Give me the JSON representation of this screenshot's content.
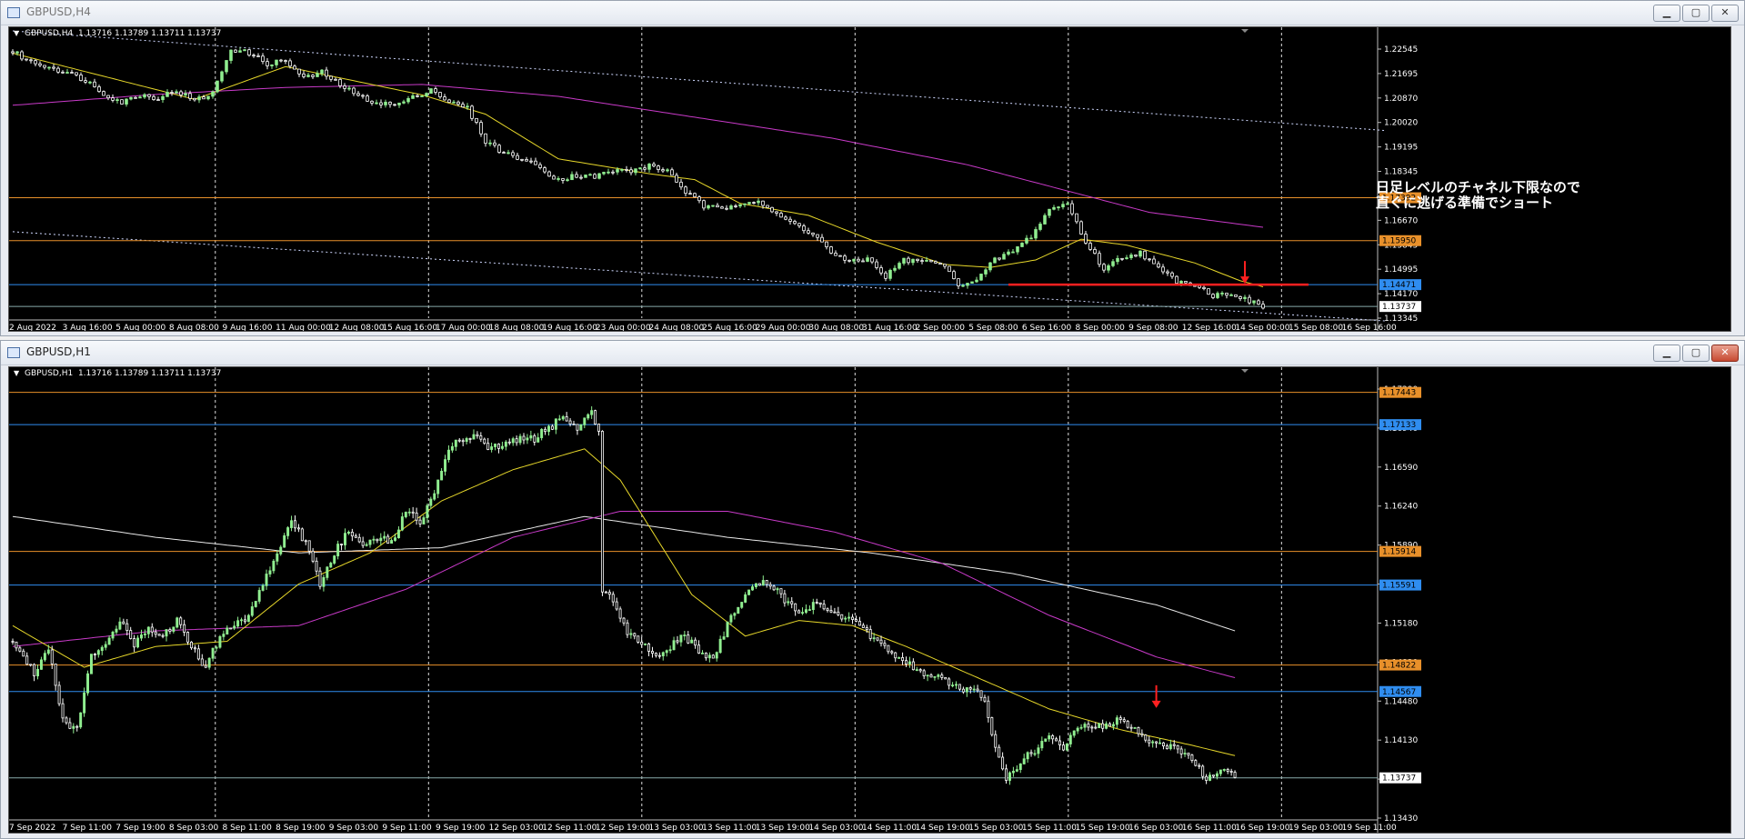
{
  "windows": [
    {
      "title": "GBPUSD,H4",
      "symbol_label": "GBPUSD,H4",
      "ohlc": "1.13716 1.13789 1.13711 1.13737",
      "annotation_line1": "日足レベルのチャネル下限なので",
      "annotation_line2": "直ぐに逃げる準備でショート"
    },
    {
      "title": "GBPUSD,H1",
      "symbol_label": "GBPUSD,H1",
      "ohlc": "1.13716 1.13789 1.13711 1.13737"
    }
  ],
  "chart_data": [
    {
      "type": "candlestick",
      "symbol": "GBPUSD",
      "timeframe": "H4",
      "ylim": [
        1.13345,
        1.23
      ],
      "y_ticks": [
        "1.22545",
        "1.21695",
        "1.20870",
        "1.20020",
        "1.19195",
        "1.18345",
        "1.17520",
        "1.16670",
        "1.15845",
        "1.14995",
        "1.14170",
        "1.13345"
      ],
      "x_ticks": [
        "2 Aug 2022",
        "3 Aug 16:00",
        "5 Aug 00:00",
        "8 Aug 08:00",
        "9 Aug 16:00",
        "11 Aug 00:00",
        "12 Aug 08:00",
        "15 Aug 16:00",
        "17 Aug 00:00",
        "18 Aug 08:00",
        "19 Aug 16:00",
        "23 Aug 00:00",
        "24 Aug 08:00",
        "25 Aug 16:00",
        "29 Aug 00:00",
        "30 Aug 08:00",
        "31 Aug 16:00",
        "2 Sep 00:00",
        "5 Sep 08:00",
        "6 Sep 16:00",
        "8 Sep 00:00",
        "9 Sep 08:00",
        "12 Sep 16:00",
        "14 Sep 00:00",
        "15 Sep 08:00",
        "16 Sep 16:00"
      ],
      "close_path": [
        [
          0,
          1.223
        ],
        [
          4,
          1.2195
        ],
        [
          8,
          1.218
        ],
        [
          12,
          1.216
        ],
        [
          16,
          1.2135
        ],
        [
          20,
          1.209
        ],
        [
          24,
          1.206
        ],
        [
          28,
          1.2085
        ],
        [
          32,
          1.2075
        ],
        [
          36,
          1.21
        ],
        [
          40,
          1.2065
        ],
        [
          44,
          1.209
        ],
        [
          48,
          1.224
        ],
        [
          52,
          1.2225
        ],
        [
          56,
          1.219
        ],
        [
          60,
          1.22
        ],
        [
          64,
          1.214
        ],
        [
          68,
          1.216
        ],
        [
          72,
          1.212
        ],
        [
          76,
          1.208
        ],
        [
          80,
          1.206
        ],
        [
          84,
          1.205
        ],
        [
          88,
          1.2075
        ],
        [
          92,
          1.2105
        ],
        [
          96,
          1.206
        ],
        [
          100,
          1.204
        ],
        [
          104,
          1.193
        ],
        [
          108,
          1.189
        ],
        [
          112,
          1.187
        ],
        [
          116,
          1.184
        ],
        [
          120,
          1.18
        ],
        [
          124,
          1.1815
        ],
        [
          128,
          1.181
        ],
        [
          132,
          1.183
        ],
        [
          136,
          1.183
        ],
        [
          140,
          1.1845
        ],
        [
          144,
          1.183
        ],
        [
          148,
          1.176
        ],
        [
          152,
          1.171
        ],
        [
          156,
          1.17
        ],
        [
          160,
          1.1725
        ],
        [
          164,
          1.173
        ],
        [
          168,
          1.168
        ],
        [
          172,
          1.165
        ],
        [
          176,
          1.162
        ],
        [
          180,
          1.1555
        ],
        [
          184,
          1.152
        ],
        [
          188,
          1.1535
        ],
        [
          192,
          1.1475
        ],
        [
          196,
          1.153
        ],
        [
          200,
          1.1525
        ],
        [
          204,
          1.152
        ],
        [
          208,
          1.145
        ],
        [
          212,
          1.146
        ],
        [
          216,
          1.153
        ],
        [
          220,
          1.156
        ],
        [
          224,
          1.161
        ],
        [
          228,
          1.17
        ],
        [
          232,
          1.172
        ],
        [
          236,
          1.159
        ],
        [
          240,
          1.15
        ],
        [
          244,
          1.154
        ],
        [
          248,
          1.1555
        ],
        [
          252,
          1.15
        ],
        [
          256,
          1.146
        ],
        [
          260,
          1.145
        ],
        [
          264,
          1.141
        ],
        [
          268,
          1.142
        ],
        [
          272,
          1.139
        ],
        [
          275,
          1.13737
        ]
      ],
      "sma_fast": [
        [
          0,
          1.2225
        ],
        [
          40,
          1.207
        ],
        [
          60,
          1.218
        ],
        [
          90,
          1.2085
        ],
        [
          104,
          1.202
        ],
        [
          120,
          1.187
        ],
        [
          140,
          1.182
        ],
        [
          150,
          1.18
        ],
        [
          160,
          1.172
        ],
        [
          175,
          1.168
        ],
        [
          190,
          1.159
        ],
        [
          205,
          1.1515
        ],
        [
          215,
          1.1505
        ],
        [
          225,
          1.153
        ],
        [
          235,
          1.16
        ],
        [
          245,
          1.158
        ],
        [
          260,
          1.152
        ],
        [
          270,
          1.146
        ],
        [
          275,
          1.144
        ]
      ],
      "sma_slow": [
        [
          0,
          1.205
        ],
        [
          30,
          1.2085
        ],
        [
          60,
          1.211
        ],
        [
          90,
          1.212
        ],
        [
          120,
          1.208
        ],
        [
          150,
          1.201
        ],
        [
          180,
          1.194
        ],
        [
          210,
          1.185
        ],
        [
          230,
          1.177
        ],
        [
          250,
          1.169
        ],
        [
          275,
          1.164
        ]
      ],
      "channel_upper": [
        [
          0,
          1.23
        ],
        [
          302,
          1.1965
        ]
      ],
      "channel_lower": [
        [
          0,
          1.1625
        ],
        [
          302,
          1.1325
        ]
      ],
      "horizontal_levels": [
        {
          "price": 1.17392,
          "label": "1.17392",
          "color": "#e8902a",
          "style": "orange"
        },
        {
          "price": 1.1595,
          "label": "1.15950",
          "color": "#e8902a",
          "style": "orange"
        },
        {
          "price": 1.14471,
          "label": "1.14471",
          "color": "#2f8df0",
          "style": "blue"
        },
        {
          "price": 1.13737,
          "label": "1.13737",
          "color": "#ffffff",
          "style": "current"
        }
      ],
      "entry_line": {
        "from": 219,
        "to": 285,
        "price": 1.1447,
        "color": "#ff2020"
      },
      "arrow": {
        "x": 271,
        "price": 1.1447,
        "color": "#ff2020"
      },
      "colors": {
        "bull": "#90ee90",
        "bear": "#ffffff",
        "sma_fast": "#e6d72a",
        "sma_slow": "#c83ac8"
      }
    },
    {
      "type": "candlestick",
      "symbol": "GBPUSD",
      "timeframe": "H1",
      "ylim": [
        1.1335,
        1.1765
      ],
      "y_ticks": [
        "1.17290",
        "1.16940",
        "1.16590",
        "1.16240",
        "1.15890",
        "1.15540",
        "1.15180",
        "1.14830",
        "1.14480",
        "1.14130",
        "1.13780",
        "1.13430"
      ],
      "x_ticks": [
        "7 Sep 2022",
        "7 Sep 11:00",
        "7 Sep 19:00",
        "8 Sep 03:00",
        "8 Sep 11:00",
        "8 Sep 19:00",
        "9 Sep 03:00",
        "9 Sep 11:00",
        "9 Sep 19:00",
        "12 Sep 03:00",
        "12 Sep 11:00",
        "12 Sep 19:00",
        "13 Sep 03:00",
        "13 Sep 11:00",
        "13 Sep 19:00",
        "14 Sep 03:00",
        "14 Sep 11:00",
        "14 Sep 19:00",
        "15 Sep 03:00",
        "15 Sep 11:00",
        "15 Sep 19:00",
        "16 Sep 03:00",
        "16 Sep 11:00",
        "16 Sep 19:00",
        "19 Sep 03:00",
        "19 Sep 11:00"
      ],
      "close_path": [
        [
          0,
          1.1505
        ],
        [
          6,
          1.1475
        ],
        [
          10,
          1.15
        ],
        [
          14,
          1.143
        ],
        [
          18,
          1.142
        ],
        [
          22,
          1.149
        ],
        [
          26,
          1.1505
        ],
        [
          30,
          1.1525
        ],
        [
          34,
          1.15
        ],
        [
          38,
          1.152
        ],
        [
          42,
          1.151
        ],
        [
          46,
          1.1525
        ],
        [
          50,
          1.15
        ],
        [
          54,
          1.148
        ],
        [
          58,
          1.151
        ],
        [
          62,
          1.152
        ],
        [
          66,
          1.153
        ],
        [
          70,
          1.156
        ],
        [
          74,
          1.159
        ],
        [
          78,
          1.162
        ],
        [
          82,
          1.16
        ],
        [
          86,
          1.156
        ],
        [
          90,
          1.159
        ],
        [
          94,
          1.161
        ],
        [
          98,
          1.16
        ],
        [
          102,
          1.1605
        ],
        [
          106,
          1.16
        ],
        [
          110,
          1.163
        ],
        [
          114,
          1.162
        ],
        [
          118,
          1.165
        ],
        [
          122,
          1.169
        ],
        [
          126,
          1.17
        ],
        [
          130,
          1.17
        ],
        [
          134,
          1.169
        ],
        [
          138,
          1.1695
        ],
        [
          142,
          1.17
        ],
        [
          146,
          1.17
        ],
        [
          150,
          1.171
        ],
        [
          154,
          1.172
        ],
        [
          158,
          1.171
        ],
        [
          162,
          1.1725
        ],
        [
          164,
          1.171
        ],
        [
          165,
          1.1555
        ],
        [
          168,
          1.1545
        ],
        [
          172,
          1.1515
        ],
        [
          176,
          1.1505
        ],
        [
          180,
          1.149
        ],
        [
          184,
          1.15
        ],
        [
          188,
          1.151
        ],
        [
          192,
          1.1495
        ],
        [
          196,
          1.149
        ],
        [
          200,
          1.152
        ],
        [
          204,
          1.1545
        ],
        [
          208,
          1.156
        ],
        [
          212,
          1.156
        ],
        [
          216,
          1.1545
        ],
        [
          220,
          1.1535
        ],
        [
          224,
          1.154
        ],
        [
          228,
          1.1535
        ],
        [
          232,
          1.1525
        ],
        [
          236,
          1.1525
        ],
        [
          240,
          1.151
        ],
        [
          244,
          1.15
        ],
        [
          248,
          1.149
        ],
        [
          252,
          1.148
        ],
        [
          256,
          1.147
        ],
        [
          260,
          1.147
        ],
        [
          264,
          1.146
        ],
        [
          268,
          1.146
        ],
        [
          272,
          1.145
        ],
        [
          275,
          1.14
        ],
        [
          278,
          1.137
        ],
        [
          282,
          1.139
        ],
        [
          286,
          1.14
        ],
        [
          290,
          1.1415
        ],
        [
          294,
          1.14
        ],
        [
          298,
          1.1425
        ],
        [
          302,
          1.142
        ],
        [
          306,
          1.1425
        ],
        [
          310,
          1.143
        ],
        [
          314,
          1.142
        ],
        [
          318,
          1.141
        ],
        [
          322,
          1.1405
        ],
        [
          326,
          1.14
        ],
        [
          330,
          1.139
        ],
        [
          334,
          1.1375
        ],
        [
          338,
          1.138
        ],
        [
          342,
          1.13737
        ]
      ],
      "sma_fast": [
        [
          0,
          1.152
        ],
        [
          20,
          1.148
        ],
        [
          40,
          1.15
        ],
        [
          60,
          1.1505
        ],
        [
          80,
          1.156
        ],
        [
          100,
          1.159
        ],
        [
          120,
          1.164
        ],
        [
          140,
          1.167
        ],
        [
          160,
          1.169
        ],
        [
          170,
          1.166
        ],
        [
          190,
          1.155
        ],
        [
          205,
          1.151
        ],
        [
          220,
          1.1525
        ],
        [
          235,
          1.152
        ],
        [
          250,
          1.15
        ],
        [
          270,
          1.147
        ],
        [
          290,
          1.144
        ],
        [
          310,
          1.142
        ],
        [
          330,
          1.1405
        ],
        [
          342,
          1.1395
        ]
      ],
      "sma_slow": [
        [
          0,
          1.15
        ],
        [
          40,
          1.1515
        ],
        [
          80,
          1.152
        ],
        [
          110,
          1.1555
        ],
        [
          140,
          1.1605
        ],
        [
          170,
          1.163
        ],
        [
          200,
          1.163
        ],
        [
          230,
          1.161
        ],
        [
          260,
          1.158
        ],
        [
          290,
          1.153
        ],
        [
          320,
          1.149
        ],
        [
          342,
          1.147
        ]
      ],
      "sma_long": [
        [
          0,
          1.1625
        ],
        [
          40,
          1.1605
        ],
        [
          80,
          1.159
        ],
        [
          120,
          1.1595
        ],
        [
          160,
          1.1625
        ],
        [
          200,
          1.1605
        ],
        [
          240,
          1.159
        ],
        [
          280,
          1.157
        ],
        [
          320,
          1.154
        ],
        [
          342,
          1.1515
        ]
      ],
      "horizontal_levels": [
        {
          "price": 1.17443,
          "label": "1.17443",
          "color": "#e8902a",
          "style": "orange"
        },
        {
          "price": 1.17133,
          "label": "1.17133",
          "color": "#2f8df0",
          "style": "blue"
        },
        {
          "price": 1.15914,
          "label": "1.15914",
          "color": "#e8902a",
          "style": "orange"
        },
        {
          "price": 1.15591,
          "label": "1.15591",
          "color": "#2f8df0",
          "style": "blue"
        },
        {
          "price": 1.14822,
          "label": "1.14822",
          "color": "#e8902a",
          "style": "orange"
        },
        {
          "price": 1.14567,
          "label": "1.14567",
          "color": "#2f8df0",
          "style": "blue"
        },
        {
          "price": 1.13737,
          "label": "1.13737",
          "color": "#ffffff",
          "style": "current"
        }
      ],
      "arrow": {
        "x": 320,
        "price": 1.144,
        "color": "#ff2020"
      },
      "colors": {
        "bull": "#90ee90",
        "bear": "#ffffff",
        "sma_fast": "#e6d72a",
        "sma_slow": "#c83ac8",
        "sma_long": "#e8e8e8"
      }
    }
  ]
}
